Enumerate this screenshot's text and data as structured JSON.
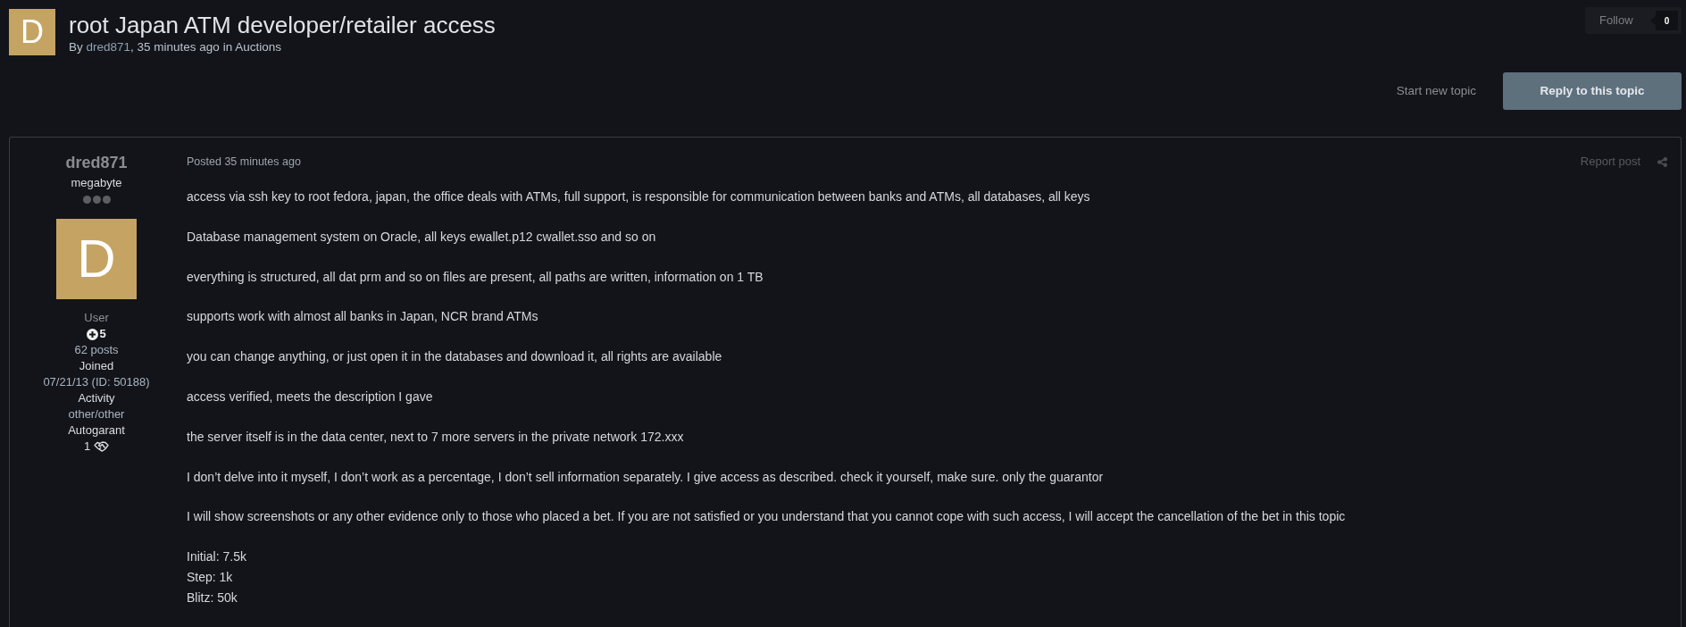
{
  "topic": {
    "avatar_letter": "D",
    "title": "root Japan ATM developer/retailer access",
    "byline": {
      "prefix": "By",
      "author": "dred871",
      "middle": ", 35 minutes ago in",
      "forum": "Auctions"
    },
    "follow": {
      "label": "Follow",
      "count": "0"
    }
  },
  "actions": {
    "start_topic": "Start new topic",
    "reply": "Reply to this topic"
  },
  "post": {
    "author": {
      "name": "dred871",
      "title": "megabyte",
      "avatar_letter": "D",
      "group": "User",
      "reputation": "5",
      "posts": "62 posts",
      "joined_label": "Joined",
      "joined": "07/21/13 (ID: 50188)",
      "activity_label": "Activity",
      "activity": "other/other",
      "autogarant_label": "Autogarant",
      "autogarant_count": "1"
    },
    "posted": "Posted 35 minutes ago",
    "report": "Report post",
    "paragraphs": [
      [
        "access via ssh key to root fedora, japan, the office deals with ATMs, full support, is responsible for communication between banks and ATMs, all databases, all keys"
      ],
      [
        "Database management system on Oracle, all keys ewallet.p12 cwallet.sso and so on"
      ],
      [
        "everything is structured, all dat prm and so on files are present, all paths are written, information on 1 TB"
      ],
      [
        "supports work with almost all banks in Japan, NCR brand ATMs"
      ],
      [
        "you can change anything, or just open it in the databases and download it, all rights are available"
      ],
      [
        "access verified, meets the description I gave"
      ],
      [
        "the server itself is in the data center, next to 7 more servers in the private network 172.xxx"
      ],
      [
        "I don’t delve into it myself, I don’t work as a percentage, I don’t sell information separately. I give access as described. check it yourself, make sure. only the guarantor"
      ],
      [
        "I will show screenshots or any other evidence only to those who placed a bet. If you are not satisfied or you understand that you cannot cope with such access, I will accept the cancellation of the bet in this topic"
      ],
      [
        "Initial: 7.5k",
        "Step: 1k",
        "Blitz: 50k"
      ]
    ]
  }
}
